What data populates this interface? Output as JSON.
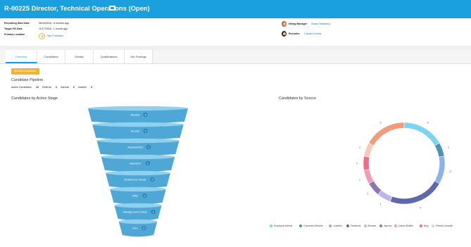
{
  "header": {
    "title": "R-00225 Director, Technical Operations (Open)"
  },
  "info": {
    "recruiting_start_label": "Recruiting Start Date",
    "recruiting_start_value": "08/19/2016 - 6 months ago",
    "target_fill_label": "Target Fill Date",
    "target_fill_value": "11/17/2016 - 1 month ago",
    "primary_location_label": "Primary Location",
    "primary_location_value": "San Francisco",
    "hiring_manager_label": "Hiring Manager",
    "hiring_manager_value": "Susan Steinberg",
    "recruiter_label": "Recruiter",
    "recruiter_value": "Carmen Cortes"
  },
  "tabs": [
    {
      "label": "Overview",
      "active": true
    },
    {
      "label": "Candidates",
      "active": false
    },
    {
      "label": "Details",
      "active": false
    },
    {
      "label": "Qualifications",
      "active": false
    },
    {
      "label": "Job Postings",
      "active": false
    }
  ],
  "review_button": "Review Candidates",
  "pipeline": {
    "title": "Candidate Pipeline",
    "stats": [
      {
        "label": "Active Candidates",
        "value": "12"
      },
      {
        "label": "Referral",
        "value": "4"
      },
      {
        "label": "Internal",
        "value": "0"
      },
      {
        "label": "Inactive",
        "value": "3"
      }
    ]
  },
  "stage_chart_title": "Candidates by Active Stage",
  "source_chart_title": "Candidates by Source",
  "funnel": {
    "stages": [
      {
        "label": "Review",
        "value": "6"
      },
      {
        "label": "Screen",
        "value": "2"
      },
      {
        "label": "Assessment",
        "value": "1"
      },
      {
        "label": "Interview",
        "value": "1"
      },
      {
        "label": "Reference Check",
        "value": "0"
      },
      {
        "label": "Offer",
        "value": "0"
      },
      {
        "label": "Background Check",
        "value": "1"
      },
      {
        "label": "Hire",
        "value": "0"
      }
    ],
    "color": "#4fa7d6"
  },
  "chart_data": {
    "type": "pie",
    "donut": true,
    "slices": [
      {
        "name": "Employee referral",
        "value": 3,
        "color": "#7dd4ef"
      },
      {
        "name": "Corporate Website",
        "value": 1,
        "color": "#4e93b7"
      },
      {
        "name": "LinkedIn",
        "value": 2,
        "color": "#8fb1ea"
      },
      {
        "name": "Facebook",
        "value": 4,
        "color": "#6068ac"
      },
      {
        "name": "Monster",
        "value": 1,
        "color": "#bfb6ea"
      },
      {
        "name": "Agency",
        "value": 1,
        "color": "#8c78b0"
      },
      {
        "name": "Career Builder",
        "value": 1,
        "color": "#f29ab8"
      },
      {
        "name": "Bing",
        "value": 1,
        "color": "#f06c86"
      },
      {
        "name": "Friends LinkedIn",
        "value": 1,
        "color": "#f8c9b8"
      },
      {
        "name": "",
        "value": 3,
        "color": "#f29b7a"
      }
    ],
    "legend_placement": "bottom"
  }
}
